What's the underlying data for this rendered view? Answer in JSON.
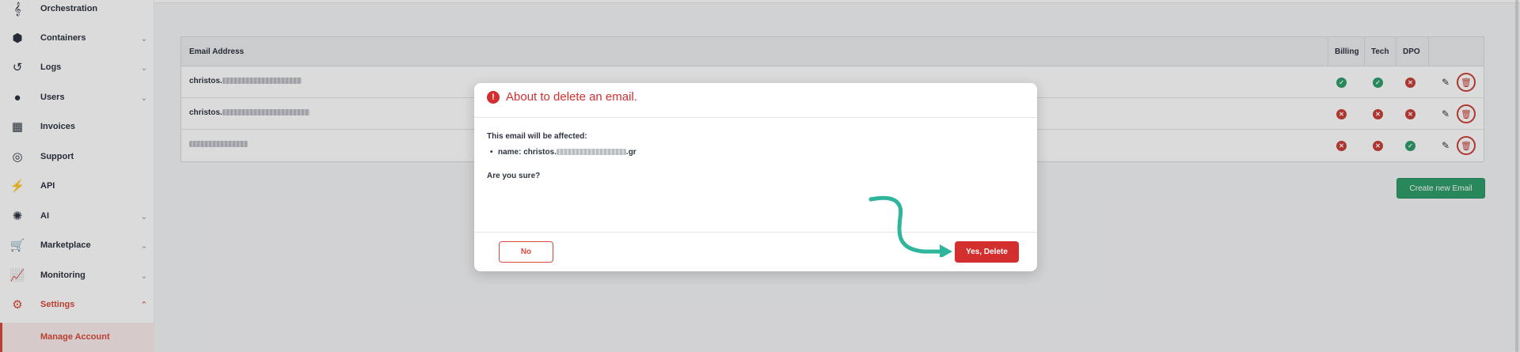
{
  "sidebar": {
    "items": [
      {
        "label": "Orchestration",
        "icon": "orchestration-icon",
        "chevron": false
      },
      {
        "label": "Containers",
        "icon": "containers-icon",
        "chevron": true
      },
      {
        "label": "Logs",
        "icon": "logs-icon",
        "chevron": true
      },
      {
        "label": "Users",
        "icon": "users-icon",
        "chevron": true
      },
      {
        "label": "Invoices",
        "icon": "invoices-icon",
        "chevron": false
      },
      {
        "label": "Support",
        "icon": "support-icon",
        "chevron": false
      },
      {
        "label": "API",
        "icon": "api-icon",
        "chevron": false
      },
      {
        "label": "AI",
        "icon": "ai-icon",
        "chevron": true
      },
      {
        "label": "Marketplace",
        "icon": "cart-icon",
        "chevron": true
      },
      {
        "label": "Monitoring",
        "icon": "chart-icon",
        "chevron": true
      },
      {
        "label": "Settings",
        "icon": "gear-icon",
        "chevron": true,
        "active": true
      }
    ],
    "sub_item": "Manage Account"
  },
  "table": {
    "headers": {
      "email": "Email Address",
      "billing": "Billing",
      "tech": "Tech",
      "dpo": "DPO"
    },
    "rows": [
      {
        "email_prefix": "christos.",
        "billing": true,
        "tech": true,
        "dpo": false
      },
      {
        "email_prefix": "christos.",
        "billing": false,
        "tech": false,
        "dpo": false
      },
      {
        "email_prefix": "",
        "billing": false,
        "tech": false,
        "dpo": true
      }
    ]
  },
  "create_button": "Create new Email",
  "modal": {
    "title": "About to delete an email.",
    "affected_label": "This email will be affected:",
    "item_prefix": "name: christos.",
    "item_suffix": ".gr",
    "confirm_question": "Are you sure?",
    "no_label": "No",
    "yes_label": "Yes, Delete"
  },
  "colors": {
    "accent": "#d84a3c",
    "danger": "#d32f2f",
    "success": "#2f9e6b",
    "arrow": "#2fb59c"
  }
}
